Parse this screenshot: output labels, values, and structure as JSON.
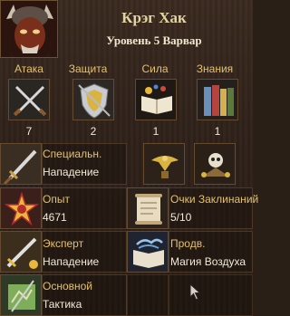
{
  "hero": {
    "name": "Крэг Хак",
    "level_class": "Уровень 5 Варвар",
    "portrait_icon": "orc-barbarian-portrait"
  },
  "primary": [
    {
      "label": "Атака",
      "value": "7",
      "icon": "crossed-swords-icon"
    },
    {
      "label": "Защита",
      "value": "2",
      "icon": "shield-icon"
    },
    {
      "label": "Сила",
      "value": "1",
      "icon": "spellbook-icon"
    },
    {
      "label": "Знания",
      "value": "1",
      "icon": "books-icon"
    }
  ],
  "specialty": {
    "title": "Специальн.",
    "value": "Нападение",
    "icon": "sword-icon"
  },
  "extras": [
    {
      "icon": "eagle-banner-icon"
    },
    {
      "icon": "skull-tent-icon"
    }
  ],
  "experience": {
    "title": "Опыт",
    "value": "4671",
    "icon": "star-badge-icon"
  },
  "spell_points": {
    "title": "Очки Заклинаний",
    "value": "5/10",
    "icon": "scroll-icon"
  },
  "skills": [
    {
      "level": "Эксперт",
      "name": "Нападение",
      "icon": "offense-skill-icon"
    },
    {
      "level": "Продв.",
      "name": "Магия Воздуха",
      "icon": "air-magic-icon"
    },
    {
      "level": "Основной",
      "name": "Тактика",
      "icon": "tactics-map-icon"
    }
  ],
  "colors": {
    "label": "#e3c16f",
    "value": "#f2ead7",
    "title": "#e3d5a3",
    "background": "#2f221a"
  }
}
